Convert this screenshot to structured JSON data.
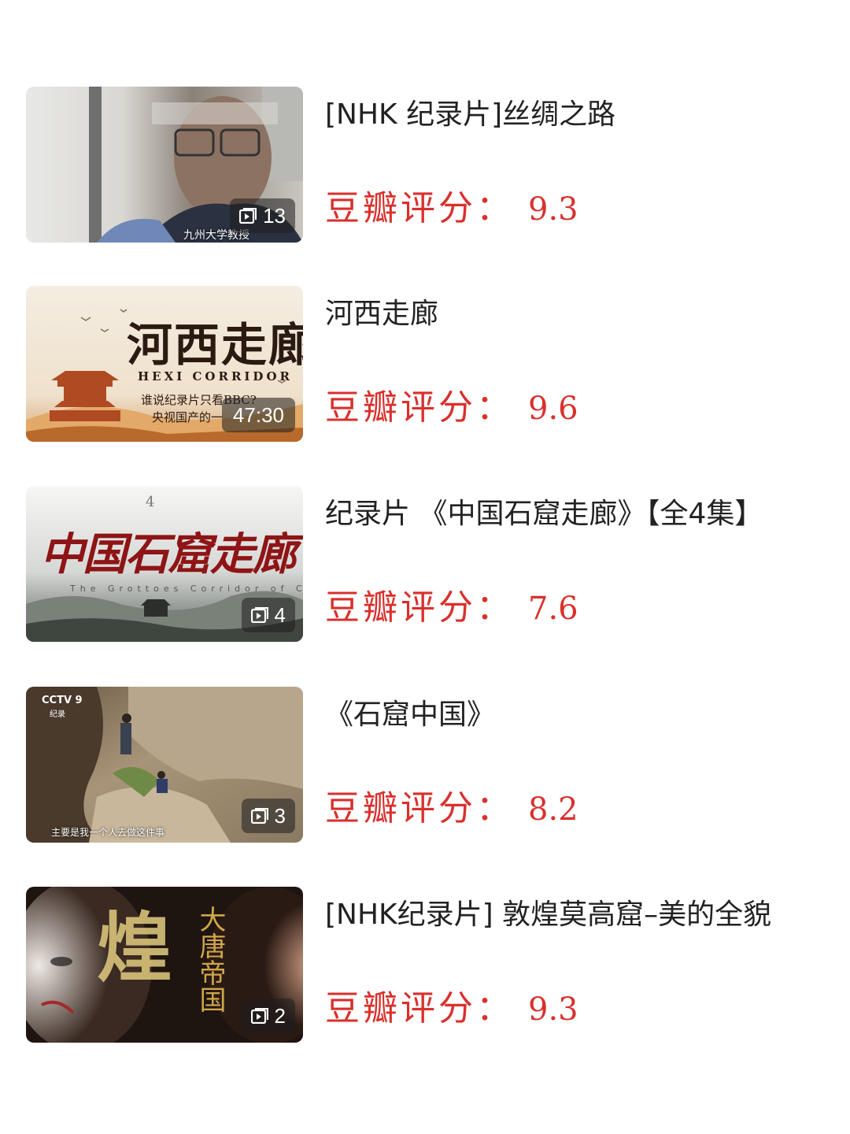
{
  "rating_label": "豆瓣评分：",
  "colors": {
    "rating": "#d9302c",
    "title": "#222222"
  },
  "items": [
    {
      "title": "[NHK  纪录片]丝绸之路",
      "rating": "9.3",
      "badge_icon": "playlist-icon",
      "badge_text": "13",
      "thumb_caption": "九州大学教授"
    },
    {
      "title": "河西走廊",
      "rating": "9.6",
      "badge_text": "47:30",
      "thumb_title": "河西走廊",
      "thumb_subtitle": "HEXI CORRIDOR",
      "thumb_line1": "谁说纪录片只看BBC?",
      "thumb_line2": "央视国产的一"
    },
    {
      "title": "纪录片  《中国石窟走廊》【全4集】",
      "rating": "7.6",
      "badge_icon": "playlist-icon",
      "badge_text": "4",
      "thumb_title": "中国石窟走廊",
      "thumb_subtitle": "The Grottoes Corridor of China",
      "thumb_top": "4"
    },
    {
      "title": "《石窟中国》",
      "rating": "8.2",
      "badge_icon": "playlist-icon",
      "badge_text": "3",
      "thumb_logo": "CCTV 9",
      "thumb_logo_sub": "纪录",
      "thumb_caption": "主要是我一个人去做这件事"
    },
    {
      "title": "[NHK纪录片]  敦煌莫高窟–美的全貌",
      "rating": "9.3",
      "badge_icon": "playlist-icon",
      "badge_text": "2",
      "thumb_title_a": "煌",
      "thumb_title_b": "大唐帝国"
    }
  ]
}
